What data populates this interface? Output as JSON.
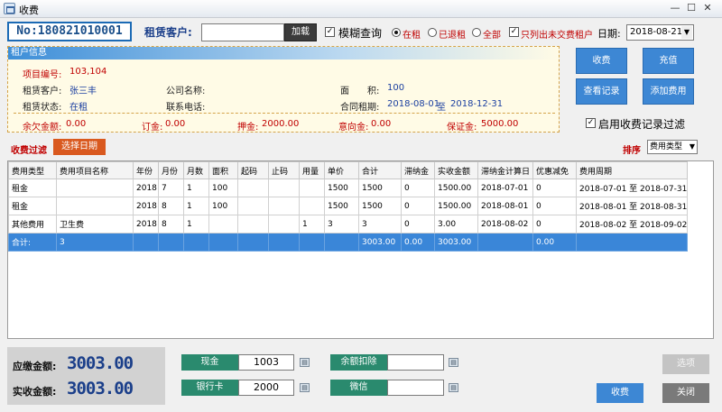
{
  "window": {
    "title": "收费",
    "minimize": "—",
    "maximize": "☐",
    "close": "✕"
  },
  "top": {
    "order_no": "No:180821010001",
    "renter_label": "租赁客户:",
    "renter_value": "",
    "load_button": "加载",
    "fuzzy_label": "模糊查询",
    "radio_active": "在租",
    "radio_returned": "已退租",
    "radio_all": "全部",
    "unpaid_only_label": "只列出未交费租户",
    "date_label": "日期:",
    "date_value": "2018-08-21"
  },
  "tenant": {
    "header": "租户信息",
    "project_no_label": "项目编号:",
    "project_no": "103,104",
    "renter_label": "租赁客户:",
    "renter_name": "张三丰",
    "company_label": "公司名称:",
    "company_value": "",
    "area_label": "面　　积:",
    "area_value": "100",
    "status_label": "租赁状态:",
    "status_value": "在租",
    "phone_label": "联系电话:",
    "phone_value": "",
    "contract_label": "合同租期:",
    "contract_from": "2018-08-01",
    "contract_to_word": "至",
    "contract_to": "2018-12-31",
    "arrears_label": "余欠金额:",
    "arrears_value": "0.00",
    "deposit_order_label": "订金:",
    "deposit_order_value": "0.00",
    "pledge_label": "押金:",
    "pledge_value": "2000.00",
    "intent_label": "意向金:",
    "intent_value": "0.00",
    "guarantee_label": "保证金:",
    "guarantee_value": "5000.00"
  },
  "actions": {
    "charge": "收费",
    "recharge": "充值",
    "view_records": "查看记录",
    "add_fee": "添加费用",
    "enable_filter_label": "启用收费记录过滤"
  },
  "filter": {
    "label": "收费过滤",
    "pick_date": "选择日期",
    "sort_label": "排序",
    "sort_value": "费用类型"
  },
  "table": {
    "headers": [
      "费用类型",
      "费用项目名称",
      "年份",
      "月份",
      "月数",
      "面积",
      "起码",
      "止码",
      "用量",
      "单价",
      "合计",
      "滞纳金",
      "实收金额",
      "滞纳金计算日",
      "优惠减免",
      "费用周期"
    ],
    "rows": [
      [
        "租金",
        "",
        "2018",
        "7",
        "1",
        "100",
        "",
        "",
        "",
        "1500",
        "1500",
        "0",
        "1500.00",
        "2018-07-01",
        "0",
        "2018-07-01 至 2018-07-31"
      ],
      [
        "租金",
        "",
        "2018",
        "8",
        "1",
        "100",
        "",
        "",
        "",
        "1500",
        "1500",
        "0",
        "1500.00",
        "2018-08-01",
        "0",
        "2018-08-01 至 2018-08-31"
      ],
      [
        "其他费用",
        "卫生费",
        "2018",
        "8",
        "1",
        "",
        "",
        "",
        "1",
        "3",
        "3",
        "0",
        "3.00",
        "2018-08-02",
        "0",
        "2018-08-02 至 2018-09-02"
      ]
    ],
    "total": [
      "合计:",
      "3",
      "",
      "",
      "",
      "",
      "",
      "",
      "",
      "",
      "3003.00",
      "0.00",
      "3003.00",
      "",
      "0.00",
      ""
    ]
  },
  "bottom": {
    "due_label": "应缴金额:",
    "due_value": "3003.00",
    "paid_label": "实收金额:",
    "paid_value": "3003.00",
    "cash_label": "现金",
    "cash_value": "1003",
    "balance_label": "余额扣除",
    "balance_value": "",
    "bank_label": "银行卡",
    "bank_value": "2000",
    "wechat_label": "微信",
    "wechat_value": "",
    "options_button": "选项",
    "charge_button": "收费",
    "close_button": "关闭"
  },
  "colors": {
    "accent_blue": "#3d87d4",
    "pay_green": "#2a8a6e",
    "alert_red": "#c00000",
    "total_row": "#3a86d8"
  }
}
